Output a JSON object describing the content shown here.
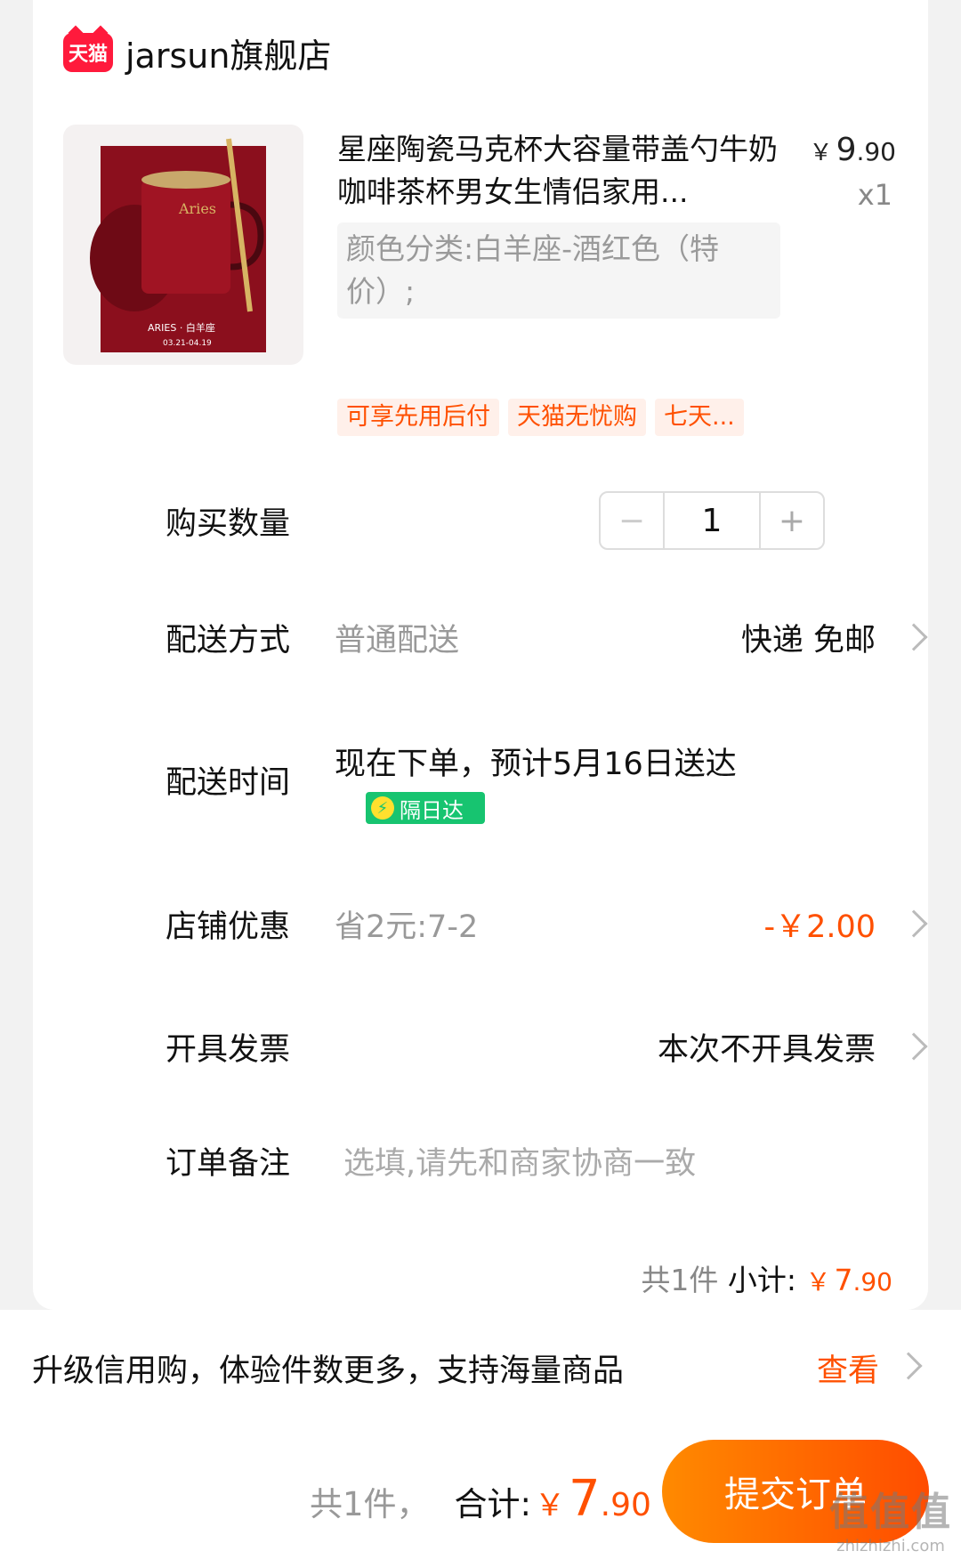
{
  "shop": {
    "platform_badge": "天猫",
    "name": "jarsun旗舰店"
  },
  "product": {
    "title": "星座陶瓷马克杯大容量带盖勺牛奶咖啡茶杯男女生情侣家用...",
    "price_currency": "￥",
    "price_int": "9",
    "price_dec": ".90",
    "quantity_label": "x1",
    "sku": "颜色分类:白羊座-酒红色（特价）;",
    "image_text": {
      "name": "Aries",
      "sign": "ARIES · 白羊座",
      "dates": "03.21-04.19"
    },
    "tags": [
      "可享先用后付",
      "天猫无忧购",
      "七天..."
    ]
  },
  "quantity": {
    "label": "购买数量",
    "minus": "−",
    "value": "1",
    "plus": "+"
  },
  "delivery": {
    "label": "配送方式",
    "type": "普通配送",
    "value": "快递 免邮"
  },
  "delivery_time": {
    "label": "配送时间",
    "value": "现在下单，预计5月16日送达",
    "badge": "隔日达",
    "badge_icon": "⚡"
  },
  "shop_discount": {
    "label": "店铺优惠",
    "desc": "省2元:7-2",
    "value": "-￥2.00"
  },
  "invoice": {
    "label": "开具发票",
    "value": "本次不开具发票"
  },
  "note": {
    "label": "订单备注",
    "placeholder": "选填,请先和商家协商一致"
  },
  "subtotal": {
    "count": "共1件",
    "label": "小计:",
    "currency": "￥",
    "int": "7",
    "dec": ".90"
  },
  "credit": {
    "text": "升级信用购，体验件数更多，支持海量商品",
    "link": "查看"
  },
  "bottom": {
    "count": "共1件，",
    "label": "合计:",
    "currency": "￥",
    "int": "7",
    "dec": ".90",
    "submit": "提交订单"
  },
  "watermark": {
    "big": "值值值",
    "small": "zhizhizhi.com"
  },
  "colors": {
    "accent": "#ff5000",
    "tmall_red": "#ff1a3c",
    "green_badge": "#17c470",
    "product_red": "#8b0f1d"
  }
}
